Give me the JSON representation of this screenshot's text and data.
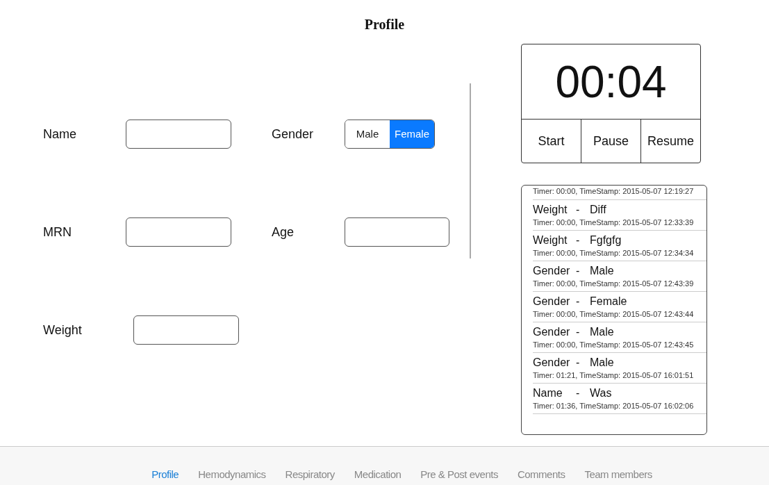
{
  "title": "Profile",
  "form": {
    "fields": [
      {
        "label": "Name"
      },
      {
        "label": "MRN"
      },
      {
        "label": "Age"
      },
      {
        "label": "Weight"
      }
    ],
    "gender": {
      "label": "Gender",
      "options": [
        {
          "label": "Male",
          "selected": false
        },
        {
          "label": "Female",
          "selected": true
        }
      ]
    }
  },
  "timer": {
    "display": "00:04",
    "buttons": [
      "Start",
      "Pause",
      "Resume"
    ]
  },
  "log": [
    {
      "detail": "Timer: 00:00, TimeStamp: 2015-05-07 12:19:27"
    },
    {
      "field": "Weight",
      "separator": "-",
      "value": "Diff",
      "detail": "Timer: 00:00, TimeStamp: 2015-05-07 12:33:39"
    },
    {
      "field": "Weight",
      "separator": "-",
      "value": "Fgfgfg",
      "detail": "Timer: 00:00, TimeStamp: 2015-05-07 12:34:34"
    },
    {
      "field": "Gender",
      "separator": "-",
      "value": "Male",
      "detail": "Timer: 00:00, TimeStamp: 2015-05-07 12:43:39"
    },
    {
      "field": "Gender",
      "separator": "-",
      "value": "Female",
      "detail": "Timer: 00:00, TimeStamp: 2015-05-07 12:43:44"
    },
    {
      "field": "Gender",
      "separator": "-",
      "value": "Male",
      "detail": "Timer: 00:00, TimeStamp: 2015-05-07 12:43:45"
    },
    {
      "field": "Gender",
      "separator": "-",
      "value": "Male",
      "detail": "Timer: 01:21, TimeStamp: 2015-05-07 16:01:51"
    },
    {
      "field": "Name",
      "separator": "-",
      "value": "Was",
      "detail": "Timer: 01:36, TimeStamp: 2015-05-07 16:02:06"
    }
  ],
  "tabs": [
    {
      "label": "Profile",
      "selected": true
    },
    {
      "label": "Hemodynamics",
      "selected": false
    },
    {
      "label": "Respiratory",
      "selected": false
    },
    {
      "label": "Medication",
      "selected": false
    },
    {
      "label": "Pre & Post events",
      "selected": false
    },
    {
      "label": "Comments",
      "selected": false
    },
    {
      "label": "Team members",
      "selected": false
    }
  ]
}
